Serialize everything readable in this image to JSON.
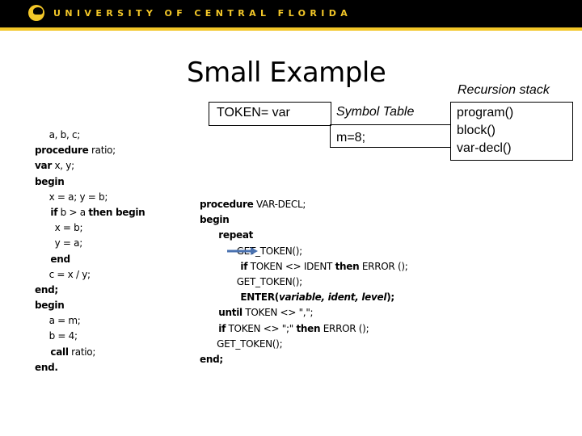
{
  "header": {
    "brand": "UNIVERSITY OF CENTRAL FLORIDA",
    "logo_icon": "pegasus-logo-icon",
    "colors": {
      "background": "#000000",
      "accent": "#f3c728"
    }
  },
  "slide": {
    "title": "Small Example",
    "token_box": "TOKEN= var",
    "symbol_table": {
      "title": "Symbol Table",
      "entries": [
        "m=8;"
      ]
    },
    "recursion_stack": {
      "title": "Recursion stack",
      "items": [
        "program()",
        "block()",
        "var-decl()"
      ]
    },
    "program_code": [
      [
        {
          "t": "     a, b, c;",
          "s": ""
        }
      ],
      [
        {
          "t": "procedure",
          "s": "b"
        },
        {
          "t": " ratio;",
          "s": ""
        }
      ],
      [
        {
          "t": "var",
          "s": "b"
        },
        {
          "t": " x, y;",
          "s": ""
        }
      ],
      [
        {
          "t": "begin",
          "s": "b"
        }
      ],
      [
        {
          "t": "     x = a; y = b;",
          "s": ""
        }
      ],
      [
        {
          "t": "     if",
          "s": "b"
        },
        {
          "t": " b > a ",
          "s": ""
        },
        {
          "t": "then begin",
          "s": "b"
        }
      ],
      [
        {
          "t": "       x = b;",
          "s": ""
        }
      ],
      [
        {
          "t": "       y = a;",
          "s": ""
        }
      ],
      [
        {
          "t": "     end",
          "s": "b"
        }
      ],
      [
        {
          "t": "     c = x / y;",
          "s": ""
        }
      ],
      [
        {
          "t": "end;",
          "s": "b"
        }
      ],
      [
        {
          "t": "begin",
          "s": "b"
        }
      ],
      [
        {
          "t": "     a = m;",
          "s": ""
        }
      ],
      [
        {
          "t": "     b = 4;",
          "s": ""
        }
      ],
      [
        {
          "t": "     call",
          "s": "b"
        },
        {
          "t": " ratio;",
          "s": ""
        }
      ],
      [
        {
          "t": "end.",
          "s": "b"
        }
      ]
    ],
    "procedure_code": [
      [
        {
          "t": "procedure",
          "s": "b"
        },
        {
          "t": " VAR-DECL;",
          "s": ""
        }
      ],
      [
        {
          "t": "begin",
          "s": "b"
        }
      ],
      [
        {
          "t": "      repeat",
          "s": "b"
        }
      ],
      [
        {
          "t": "             GET_TOKEN();",
          "s": ""
        }
      ],
      [
        {
          "t": "             if",
          "s": "b"
        },
        {
          "t": " TOKEN <> IDENT ",
          "s": ""
        },
        {
          "t": "then",
          "s": "b"
        },
        {
          "t": " ERROR ();",
          "s": ""
        }
      ],
      [
        {
          "t": "             GET_TOKEN();",
          "s": ""
        }
      ],
      [
        {
          "t": "             ENTER(",
          "s": "b"
        },
        {
          "t": "variable, ident, level",
          "s": "bi"
        },
        {
          "t": ");",
          "s": "b"
        }
      ],
      [
        {
          "t": "      until",
          "s": "b"
        },
        {
          "t": " TOKEN <> \",\";",
          "s": ""
        }
      ],
      [
        {
          "t": "      if",
          "s": "b"
        },
        {
          "t": " TOKEN <> \";\" ",
          "s": ""
        },
        {
          "t": "then",
          "s": "b"
        },
        {
          "t": " ERROR ();",
          "s": ""
        }
      ],
      [
        {
          "t": "      GET_TOKEN();",
          "s": ""
        }
      ],
      [
        {
          "t": "end;",
          "s": "b"
        }
      ]
    ],
    "pointer_arrow": {
      "icon": "right-arrow-icon",
      "points_to_line": 4,
      "color": "#4a72b0"
    }
  }
}
